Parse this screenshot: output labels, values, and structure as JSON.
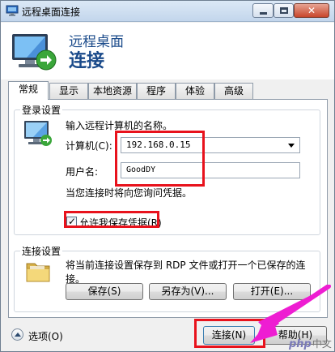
{
  "window": {
    "title": "远程桌面连接",
    "controls": {
      "close": "✕"
    }
  },
  "header": {
    "line1": "远程桌面",
    "line2": "连接"
  },
  "tabs": [
    {
      "label": "常规",
      "active": true
    },
    {
      "label": "显示",
      "active": false
    },
    {
      "label": "本地资源",
      "active": false
    },
    {
      "label": "程序",
      "active": false
    },
    {
      "label": "体验",
      "active": false
    },
    {
      "label": "高级",
      "active": false
    }
  ],
  "login": {
    "legend": "登录设置",
    "prompt": "输入远程计算机的名称。",
    "computer_label": "计算机(C):",
    "computer_value": "192.168.0.15",
    "username_label": "用户名:",
    "username_value": "GoodDY",
    "credentials_note": "当您连接时将向您询问凭据。",
    "allow_save_label": "允许我保存凭据(R)",
    "allow_save_checked": true
  },
  "connection": {
    "legend": "连接设置",
    "description_line1": "将当前连接设置保存到 RDP 文件或打开一个已保存的连",
    "description_line2": "接。",
    "save_button": "保存(S)",
    "save_as_button": "另存为(V)...",
    "open_button": "打开(E)..."
  },
  "footer": {
    "options_label": "选项(O)",
    "connect_button": "连接(N)",
    "help_button": "帮助(H)"
  },
  "watermark": {
    "brand": "php",
    "suffix": "中文网"
  },
  "colors": {
    "highlight_red": "#e8121c",
    "arrow_magenta": "#ee1dd2",
    "title_blue": "#1a4a8a"
  },
  "icons": [
    "remote-desktop-icon",
    "computer-icon",
    "folder-icon",
    "chevron-up-icon",
    "pointer-arrow"
  ]
}
